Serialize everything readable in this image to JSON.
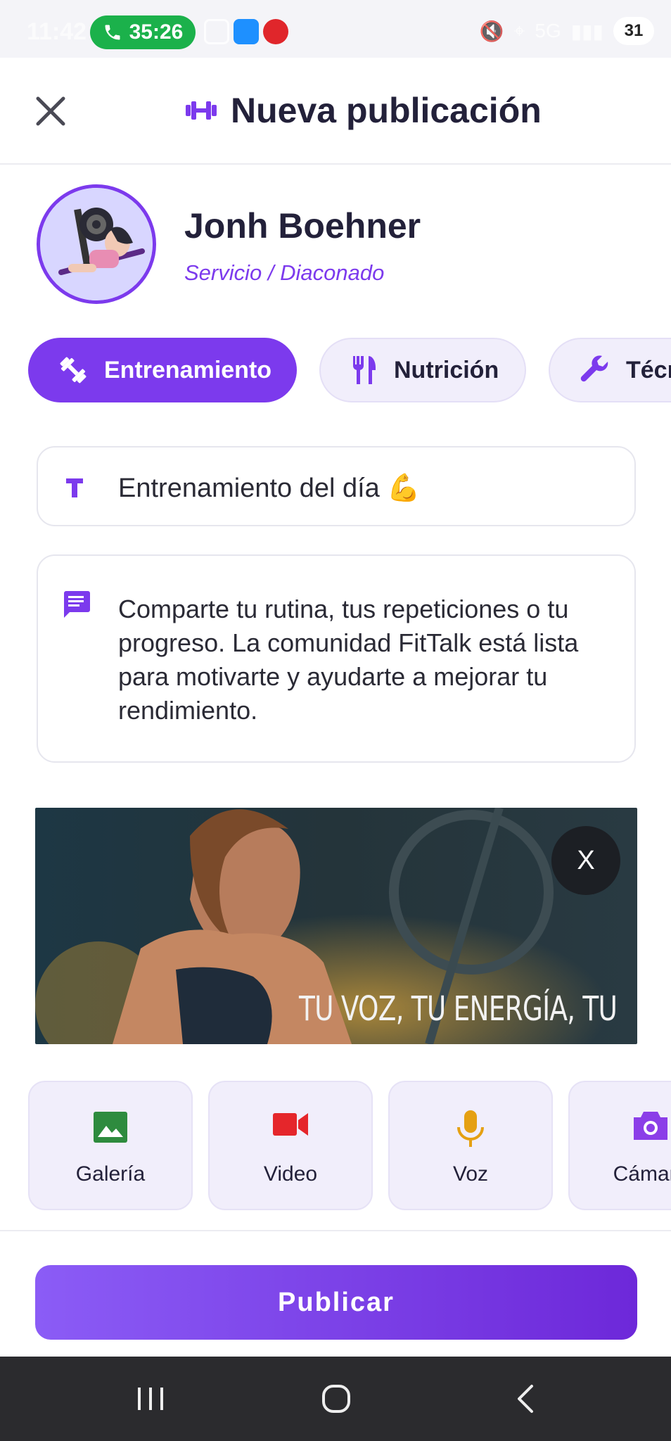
{
  "status_bar": {
    "time": "11:42",
    "call_timer": "35:26",
    "network": "5G",
    "battery": "31"
  },
  "header": {
    "title": "Nueva publicación"
  },
  "profile": {
    "name": "Jonh Boehner",
    "role": "Servicio / Diaconado"
  },
  "categories": [
    {
      "label": "Entrenamiento",
      "icon": "dumbbell-icon",
      "active": true
    },
    {
      "label": "Nutrición",
      "icon": "fork-knife-icon",
      "active": false
    },
    {
      "label": "Técnica",
      "icon": "wrench-icon",
      "active": false
    }
  ],
  "title_field": {
    "value": "Entrenamiento del día 💪"
  },
  "body_field": {
    "placeholder": "Comparte tu rutina, tus repeticiones o tu progreso. La comunidad FitTalk está lista para motivarte y ayudarte a mejorar tu rendimiento."
  },
  "image": {
    "caption": "TU VOZ, TU ENERGÍA, TU",
    "remove_label": "X"
  },
  "media_buttons": [
    {
      "label": "Galería",
      "icon": "image-icon",
      "color": "#2e8b3e"
    },
    {
      "label": "Video",
      "icon": "video-camera-icon",
      "color": "#e5262b"
    },
    {
      "label": "Voz",
      "icon": "microphone-icon",
      "color": "#e5a012"
    },
    {
      "label": "Cámara",
      "icon": "camera-icon",
      "color": "#8b3ee8"
    }
  ],
  "publish_label": "Publicar",
  "colors": {
    "accent": "#7c3aed",
    "chip_bg": "#f1eefb",
    "text_dark": "#23213a"
  }
}
